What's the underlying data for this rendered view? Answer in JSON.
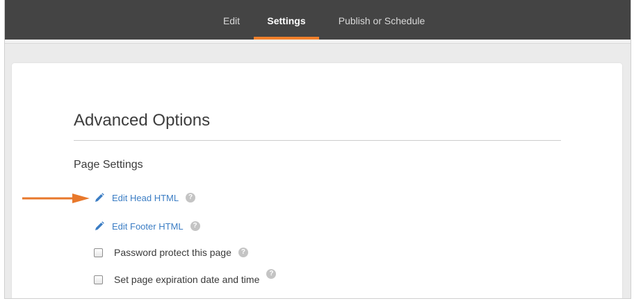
{
  "tabs": [
    {
      "label": "Edit",
      "active": false
    },
    {
      "label": "Settings",
      "active": true
    },
    {
      "label": "Publish or Schedule",
      "active": false
    }
  ],
  "colors": {
    "accent": "#f07f2a",
    "link": "#3b7dc4",
    "topbar": "#444444",
    "arrow": "#e8782b"
  },
  "advanced": {
    "title": "Advanced Options",
    "section_title": "Page Settings",
    "links": [
      {
        "label": "Edit Head HTML",
        "icon": "pencil-icon"
      },
      {
        "label": "Edit Footer HTML",
        "icon": "pencil-icon"
      }
    ],
    "checkboxes": [
      {
        "label": "Password protect this page",
        "checked": false
      },
      {
        "label": "Set page expiration date and time",
        "checked": false
      }
    ],
    "help_glyph": "?"
  }
}
